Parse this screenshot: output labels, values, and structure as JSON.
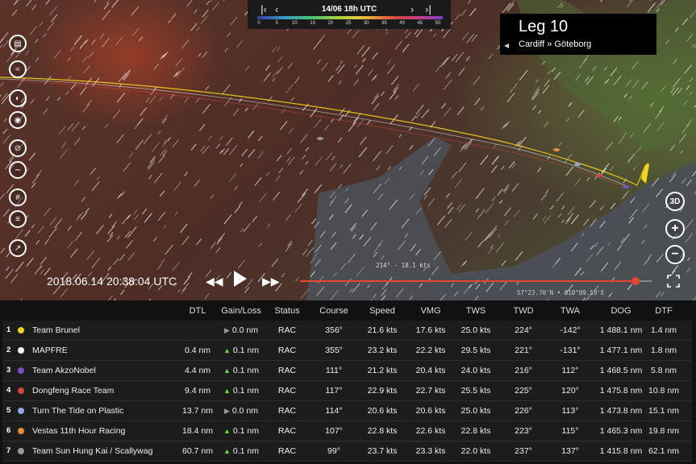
{
  "timebar": {
    "time": "14/06 18h UTC",
    "first_icon": "skip-start-icon",
    "prev_icon": "prev-icon",
    "next_icon": "next-icon",
    "last_icon": "skip-end-icon",
    "scale_ticks": [
      "0",
      "5",
      "10",
      "15",
      "20",
      "25",
      "30",
      "35",
      "40",
      "45",
      "50"
    ]
  },
  "leg": {
    "title": "Leg 10",
    "route": "Cardiff » Göteborg"
  },
  "playback": {
    "datetime": "2018.06.14 20:38:04 UTC",
    "progress_fraction": 0.955
  },
  "map": {
    "wind_readout": "214° - 18.1 kts",
    "coords": "57°23.70'N • 010°09.59'E"
  },
  "left_tools": [
    "book-icon",
    "route-icon",
    "gauge-icon",
    "camera-icon",
    "no-wind-icon",
    "current-icon",
    "grid-icon",
    "layers-icon",
    "chart-icon"
  ],
  "right_tools": {
    "view3d": "3D"
  },
  "colors": {
    "accent": "#e8442e",
    "gain": "#6fcf3c"
  },
  "table": {
    "headers": [
      "DTL",
      "Gain/Loss",
      "Status",
      "Course",
      "Speed",
      "VMG",
      "TWS",
      "TWD",
      "TWA",
      "DOG",
      "DTF"
    ],
    "rows": [
      {
        "rank": "1",
        "color": "#f2d31b",
        "name": "Team Brunel",
        "dtl": "",
        "trend": "flat",
        "gain": "0.0 nm",
        "status": "RAC",
        "course": "356°",
        "speed": "21.6 kts",
        "vmg": "17.6 kts",
        "tws": "25.0 kts",
        "twd": "224°",
        "twa": "-142°",
        "dog": "1 488.1 nm",
        "dtf": "1.4 nm"
      },
      {
        "rank": "2",
        "color": "#ffffff",
        "name": "MAPFRE",
        "dtl": "0.4 nm",
        "trend": "up",
        "gain": "0.1 nm",
        "status": "RAC",
        "course": "355°",
        "speed": "23.2 kts",
        "vmg": "22.2 kts",
        "tws": "29.5 kts",
        "twd": "221°",
        "twa": "-131°",
        "dog": "1 477.1 nm",
        "dtf": "1.8 nm"
      },
      {
        "rank": "3",
        "color": "#7a4fc4",
        "name": "Team AkzoNobel",
        "dtl": "4.4 nm",
        "trend": "up",
        "gain": "0.1 nm",
        "status": "RAC",
        "course": "111°",
        "speed": "21.2 kts",
        "vmg": "20.4 kts",
        "tws": "24.0 kts",
        "twd": "216°",
        "twa": "112°",
        "dog": "1 468.5 nm",
        "dtf": "5.8 nm"
      },
      {
        "rank": "4",
        "color": "#d2463c",
        "name": "Dongfeng Race Team",
        "dtl": "9.4 nm",
        "trend": "up",
        "gain": "0.1 nm",
        "status": "RAC",
        "course": "117°",
        "speed": "22.9 kts",
        "vmg": "22.7 kts",
        "tws": "25.5 kts",
        "twd": "225°",
        "twa": "120°",
        "dog": "1 475.8 nm",
        "dtf": "10.8 nm"
      },
      {
        "rank": "5",
        "color": "#8fa5e0",
        "name": "Turn The Tide on Plastic",
        "dtl": "13.7 nm",
        "trend": "flat",
        "gain": "0.0 nm",
        "status": "RAC",
        "course": "114°",
        "speed": "20.6 kts",
        "vmg": "20.6 kts",
        "tws": "25.0 kts",
        "twd": "226°",
        "twa": "113°",
        "dog": "1 473.8 nm",
        "dtf": "15.1 nm"
      },
      {
        "rank": "6",
        "color": "#e68c3c",
        "name": "Vestas 11th Hour Racing",
        "dtl": "18.4 nm",
        "trend": "up",
        "gain": "0.1 nm",
        "status": "RAC",
        "course": "107°",
        "speed": "22.8 kts",
        "vmg": "22.6 kts",
        "tws": "22.8 kts",
        "twd": "223°",
        "twa": "115°",
        "dog": "1 465.3 nm",
        "dtf": "19.8 nm"
      },
      {
        "rank": "7",
        "color": "#9a9a9a",
        "name": "Team Sun Hung Kai / Scallywag",
        "dtl": "60.7 nm",
        "trend": "up",
        "gain": "0.1 nm",
        "status": "RAC",
        "course": "99°",
        "speed": "23.7 kts",
        "vmg": "23.3 kts",
        "tws": "22.0 kts",
        "twd": "237°",
        "twa": "137°",
        "dog": "1 415.8 nm",
        "dtf": "62.1 nm"
      }
    ]
  }
}
